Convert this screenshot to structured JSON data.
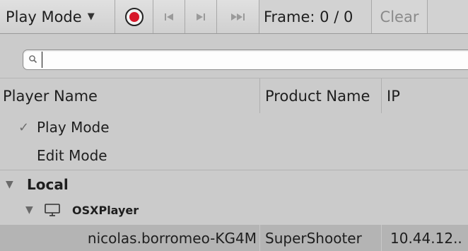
{
  "toolbar": {
    "play_mode_label": "Play Mode",
    "frame_label": "Frame: 0 / 0",
    "clear_label": "Clear",
    "record_color": "#d7182a"
  },
  "search": {
    "value": "",
    "placeholder": ""
  },
  "columns": [
    "Player Name",
    "Product Name",
    "IP"
  ],
  "modes": [
    {
      "label": "Play Mode",
      "checked": true
    },
    {
      "label": "Edit Mode",
      "checked": false
    }
  ],
  "groups": {
    "local_label": "Local",
    "device_label": "OSXPlayer"
  },
  "players": [
    {
      "name": "nicolas.borromeo-KG4M",
      "product": "SuperShooter",
      "ip": "10.44.12.."
    }
  ]
}
